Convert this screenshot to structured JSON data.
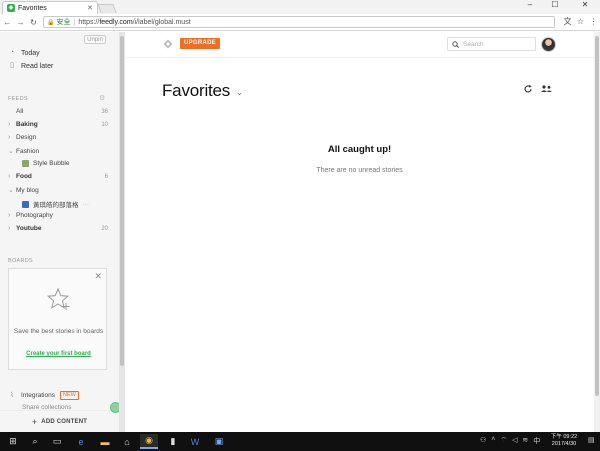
{
  "browser": {
    "tab_title": "Favorites",
    "secure_label": "安全",
    "url_scheme": "https://",
    "url_host": "feedly.com",
    "url_path": "/i/label/global.must"
  },
  "sidebar": {
    "unpin_label": "Unpin",
    "nav": [
      {
        "label": "Today"
      },
      {
        "label": "Read later"
      }
    ],
    "feeds_heading": "FEEDS",
    "feeds": [
      {
        "label": "All",
        "count": "36",
        "bold": false
      },
      {
        "label": "Baking",
        "count": "10",
        "bold": true
      },
      {
        "label": "Design",
        "count": "",
        "bold": false
      },
      {
        "label": "Fashion",
        "count": "",
        "bold": false
      },
      {
        "label": "Style Bubble",
        "count": "",
        "bold": false
      },
      {
        "label": "Food",
        "count": "6",
        "bold": true
      },
      {
        "label": "My blog",
        "count": "",
        "bold": false
      },
      {
        "label": "黃琪皓的部落格",
        "count": "",
        "bold": false
      },
      {
        "label": "Photography",
        "count": "",
        "bold": false
      },
      {
        "label": "Youtube",
        "count": "20",
        "bold": true
      }
    ],
    "boards_heading": "BOARDS",
    "board_card": {
      "text": "Save the best stories in boards",
      "link": "Create your first board"
    },
    "integrations_label": "Integrations",
    "new_badge": "NEW",
    "share_label": "Share collections",
    "add_content_label": "ADD CONTENT"
  },
  "main": {
    "upgrade_label": "UPGRADE",
    "search_placeholder": "Search",
    "page_title": "Favorites",
    "empty_title": "All caught up!",
    "empty_subtitle": "There are no unread stories"
  },
  "taskbar": {
    "clock_line1": "下午 09:22",
    "clock_line2": "2017/4/30"
  },
  "colors": {
    "accent_green": "#2bb24c",
    "upgrade_orange": "#f26c22"
  }
}
